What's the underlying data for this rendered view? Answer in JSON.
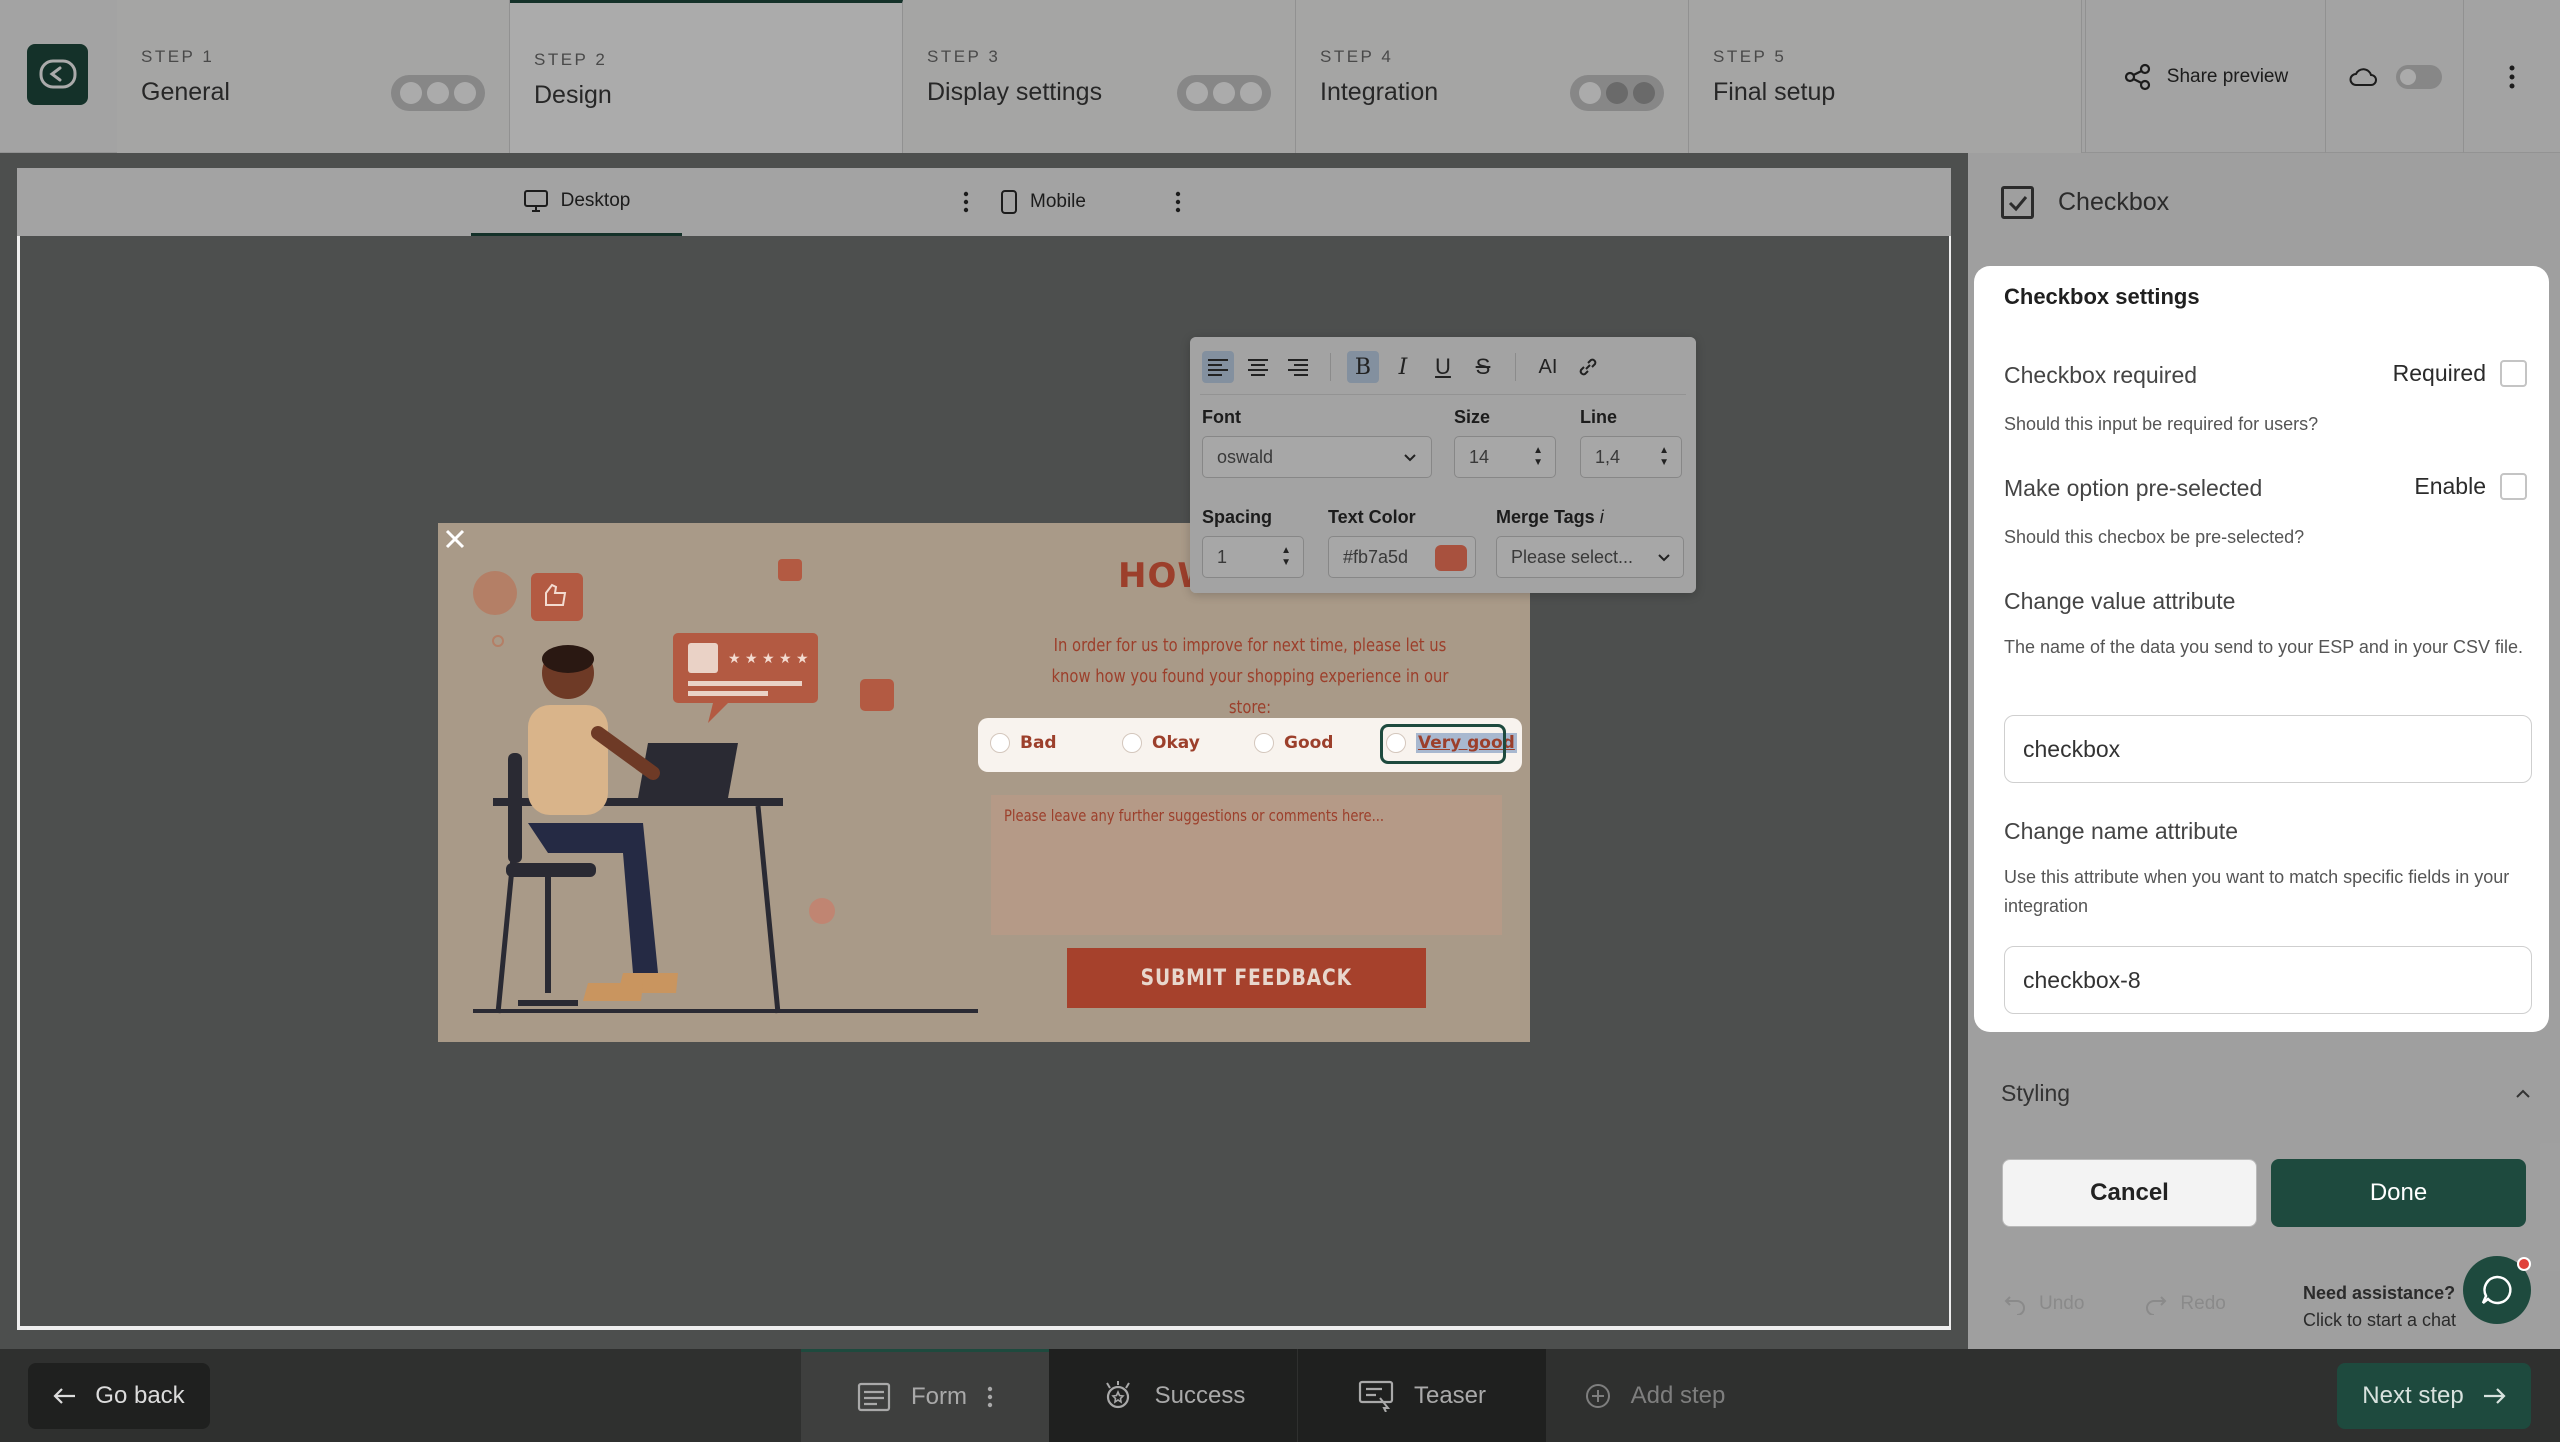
{
  "steps": [
    {
      "num": "STEP 1",
      "title": "General"
    },
    {
      "num": "STEP 2",
      "title": "Design"
    },
    {
      "num": "STEP 3",
      "title": "Display settings"
    },
    {
      "num": "STEP 4",
      "title": "Integration"
    },
    {
      "num": "STEP 5",
      "title": "Final setup"
    }
  ],
  "header": {
    "share_label": "Share preview"
  },
  "device_tabs": {
    "desktop": "Desktop",
    "mobile": "Mobile"
  },
  "popup": {
    "title": "HOW DID WE DO?",
    "subtitle": "In order for us to improve for next time, please let us know how you found your shopping experience in our store:",
    "options": [
      "Bad",
      "Okay",
      "Good",
      "Very good"
    ],
    "comment_placeholder": "Please leave any further suggestions or comments here...",
    "submit_label": "SUBMIT FEEDBACK"
  },
  "format_toolbar": {
    "font_label": "Font",
    "font_value": "oswald",
    "size_label": "Size",
    "size_value": "14",
    "line_label": "Line",
    "line_value": "1,4",
    "spacing_label": "Spacing",
    "spacing_value": "1",
    "text_color_label": "Text Color",
    "text_color_value": "#fb7a5d",
    "merge_tags_label": "Merge Tags",
    "merge_tags_value": "Please select...",
    "ai_label": "AI"
  },
  "right_panel": {
    "header_title": "Checkbox",
    "card_title": "Checkbox settings",
    "required_label": "Checkbox required",
    "required_toggle_label": "Required",
    "required_help": "Should this input be required for users?",
    "preselect_label": "Make option pre-selected",
    "preselect_toggle_label": "Enable",
    "preselect_help": "Should this checbox be pre-selected?",
    "value_attr_label": "Change value attribute",
    "value_attr_help": "The name of the data you send to your ESP and in your CSV file.",
    "value_attr_value": "checkbox",
    "name_attr_label": "Change name attribute",
    "name_attr_help": "Use this attribute when you want to match specific fields in your integration",
    "name_attr_value": "checkbox-8",
    "styling_label": "Styling",
    "cancel_label": "Cancel",
    "done_label": "Done",
    "undo_label": "Undo",
    "redo_label": "Redo",
    "assist_title": "Need assistance?",
    "assist_sub": "Click to start a chat"
  },
  "bottom": {
    "go_back": "Go back",
    "tabs": [
      "Form",
      "Success",
      "Teaser"
    ],
    "add_step": "Add step",
    "next_step": "Next step"
  },
  "colors": {
    "brand": "#1e4a3e",
    "popup_accent": "#9c3f2b",
    "text_color_swatch": "#fb7a5d"
  }
}
